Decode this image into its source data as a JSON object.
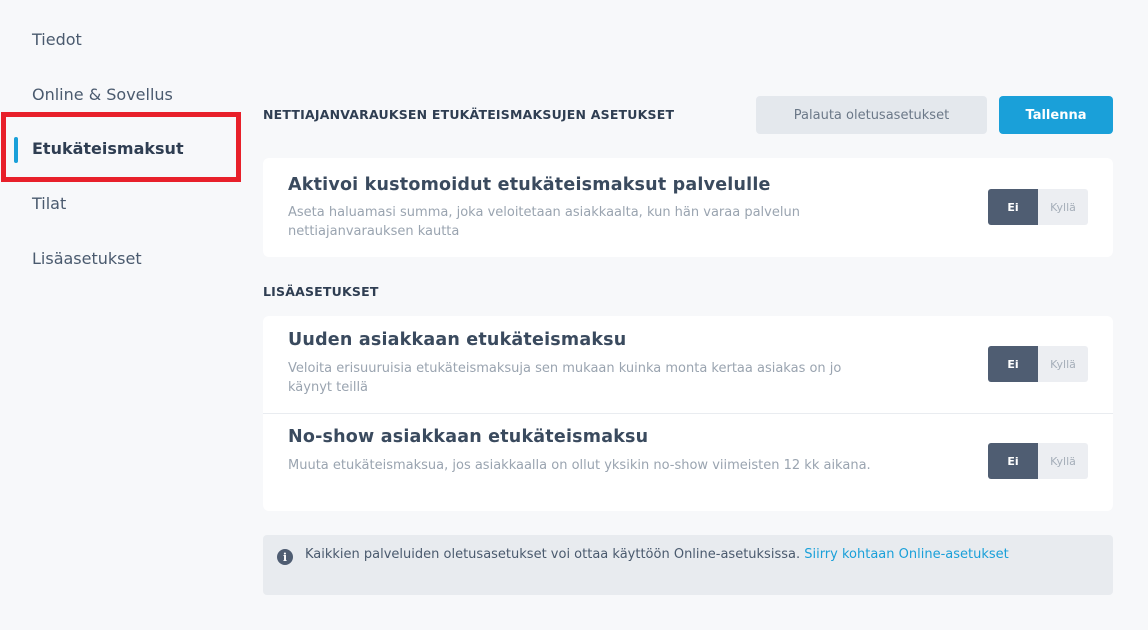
{
  "sidebar": {
    "items": [
      {
        "label": "Tiedot"
      },
      {
        "label": "Online & Sovellus"
      },
      {
        "label": "Etukäteismaksut"
      },
      {
        "label": "Tilat"
      },
      {
        "label": "Lisäasetukset"
      }
    ],
    "active_index": 2
  },
  "header": {
    "title": "NETTIAJANVARAUKSEN ETUKÄTEISMAKSUJEN ASETUKSET",
    "reset_label": "Palauta oletusasetukset",
    "save_label": "Tallenna"
  },
  "custom_prepayment": {
    "title": "Aktivoi kustomoidut etukäteismaksut palvelulle",
    "description": "Aseta haluamasi summa, joka veloitetaan asiakkaalta, kun hän varaa palvelun nettiajanvarauksen kautta",
    "toggle_no": "Ei",
    "toggle_yes": "Kyllä",
    "selected": "Ei"
  },
  "additional": {
    "title": "LISÄASETUKSET",
    "rows": [
      {
        "title": "Uuden asiakkaan etukäteismaksu",
        "description": "Veloita erisuuruisia etukäteismaksuja sen mukaan kuinka monta kertaa asiakas on jo käynyt teillä",
        "toggle_no": "Ei",
        "toggle_yes": "Kyllä",
        "selected": "Ei"
      },
      {
        "title": "No-show asiakkaan etukäteismaksu",
        "description": "Muuta etukäteismaksua, jos asiakkaalla on ollut yksikin no-show viimeisten 12 kk aikana.",
        "toggle_no": "Ei",
        "toggle_yes": "Kyllä",
        "selected": "Ei"
      }
    ]
  },
  "info": {
    "text": "Kaikkien palveluiden oletusasetukset voi ottaa käyttöön Online-asetuksissa. ",
    "link": "Siirry kohtaan Online-asetukset"
  },
  "colors": {
    "accent": "#1aa0d9",
    "highlight": "#e8202a",
    "toggle_active": "#4f5d72"
  }
}
